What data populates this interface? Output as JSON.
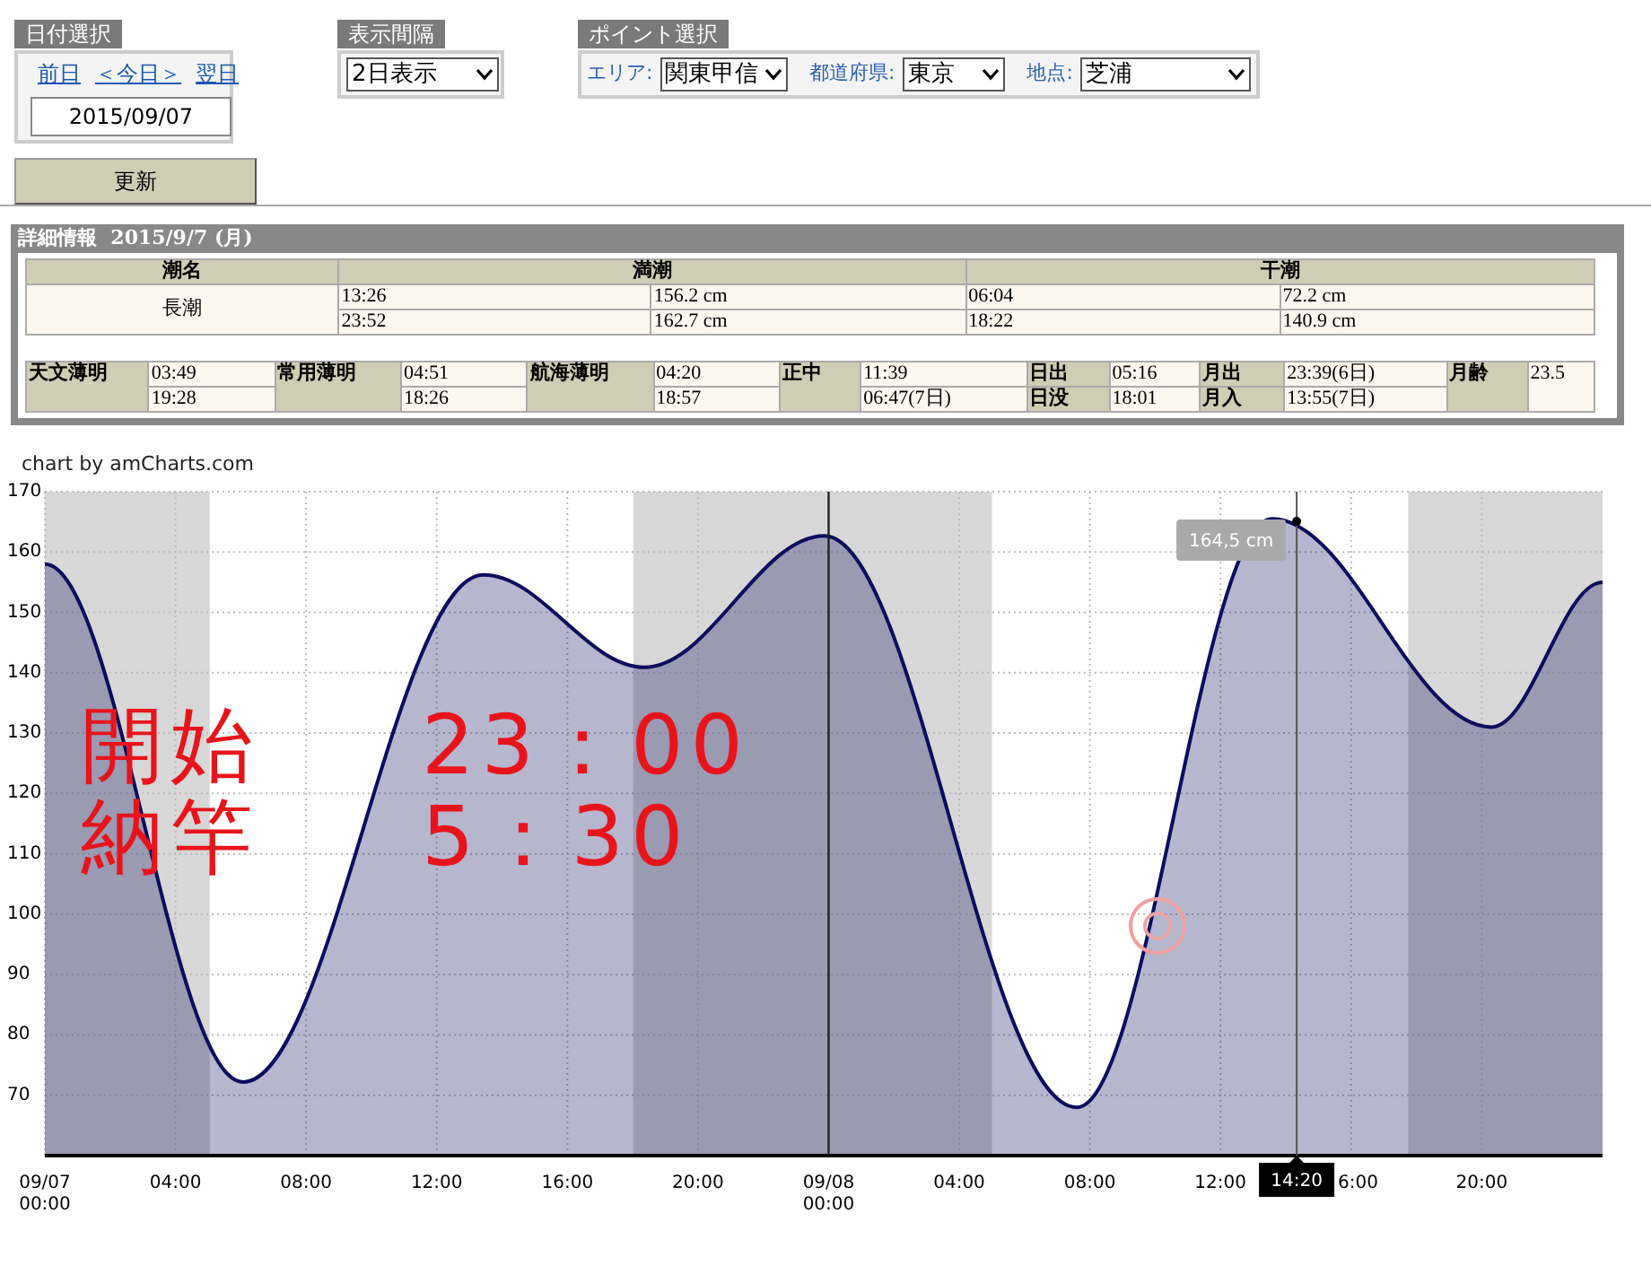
{
  "date_select": {
    "title": "日付選択",
    "links": [
      "前日",
      "＜今日＞",
      "翌日"
    ],
    "date": "2015/09/07"
  },
  "update_button": "更新",
  "interval_select": {
    "title": "表示間隔",
    "value": "2日表示"
  },
  "point_select": {
    "title": "ポイント選択",
    "fields": [
      {
        "label": "エリア:",
        "value": "関東甲信"
      },
      {
        "label": "都道府県:",
        "value": "東京"
      },
      {
        "label": "地点:",
        "value": "芝浦"
      }
    ]
  },
  "details": {
    "title": "詳細情報",
    "date": "2015/9/7 (月)",
    "tide_table": {
      "columns": [
        "潮名",
        "満潮",
        "干潮"
      ],
      "tide_name": "長潮",
      "rows": [
        {
          "high_time": "13:26",
          "high_level": "156.2 cm",
          "low_time": "06:04",
          "low_level": "72.2 cm"
        },
        {
          "high_time": "23:52",
          "high_level": "162.7 cm",
          "low_time": "18:22",
          "low_level": "140.9 cm"
        }
      ]
    },
    "astro": [
      {
        "kind": "span",
        "label": "天文薄明",
        "values": [
          "03:49",
          "19:28"
        ]
      },
      {
        "kind": "span",
        "label": "常用薄明",
        "values": [
          "04:51",
          "18:26"
        ]
      },
      {
        "kind": "span",
        "label": "航海薄明",
        "values": [
          "04:20",
          "18:57"
        ]
      },
      {
        "kind": "span",
        "label": "正中",
        "values": [
          "11:39",
          "06:47(7日)"
        ]
      },
      {
        "kind": "pair",
        "labels": [
          "日出",
          "日没"
        ],
        "values": [
          "05:16",
          "18:01"
        ]
      },
      {
        "kind": "pair",
        "labels": [
          "月出",
          "月入"
        ],
        "values": [
          "23:39(6日)",
          "13:55(7日)"
        ]
      },
      {
        "kind": "single",
        "label": "月齢",
        "value": "23.5"
      }
    ]
  },
  "chart_credit": "chart by amCharts.com",
  "chart": {
    "chart_data": {
      "type": "area",
      "grid": true,
      "x": [
        "2015-09-07T00:00",
        "2015-09-07T06:04",
        "2015-09-07T13:26",
        "2015-09-07T18:22",
        "2015-09-07T23:52",
        "2015-09-08T07:36",
        "2015-09-08T13:35",
        "2015-09-08T20:18",
        "2015-09-08T23:42"
      ],
      "series": [
        {
          "color": "#0d0d5e",
          "values": [
            158,
            72.2,
            156.2,
            140.9,
            162.7,
            68,
            165.5,
            131,
            155
          ]
        }
      ],
      "xlim": [
        "2015-09-07T00:00",
        "2015-09-08T23:42"
      ],
      "ylim": [
        60,
        170
      ],
      "yticks": [
        70,
        80,
        90,
        100,
        110,
        120,
        130,
        140,
        150,
        160,
        170
      ],
      "xticks": [
        {
          "value": "2015-09-07T00:00",
          "label": "09/07 00:00"
        },
        {
          "value": "2015-09-07T04:00",
          "label": "04:00"
        },
        {
          "value": "2015-09-07T08:00",
          "label": "08:00"
        },
        {
          "value": "2015-09-07T12:00",
          "label": "12:00"
        },
        {
          "value": "2015-09-07T16:00",
          "label": "16:00"
        },
        {
          "value": "2015-09-07T20:00",
          "label": "20:00"
        },
        {
          "value": "2015-09-08T00:00",
          "label": "09/08 00:00"
        },
        {
          "value": "2015-09-08T04:00",
          "label": "04:00"
        },
        {
          "value": "2015-09-08T08:00",
          "label": "08:00"
        },
        {
          "value": "2015-09-08T12:00",
          "label": "12:00"
        },
        {
          "value": "2015-09-08T16:00",
          "label": "6:00"
        },
        {
          "value": "2015-09-08T20:00",
          "label": "20:00"
        }
      ],
      "bands": [
        {
          "axis": "x",
          "from": "2015-09-07T00:00",
          "to": "2015-09-07T05:03"
        },
        {
          "axis": "x",
          "from": "2015-09-07T18:01",
          "to": "2015-09-08T05:00"
        },
        {
          "axis": "x",
          "from": "2015-09-08T17:45",
          "to": "2015-09-08T23:42"
        }
      ],
      "ref_lines": [
        {
          "axis": "x",
          "value": "2015-09-08T00:00"
        },
        {
          "axis": "x",
          "value": "2015-09-08T14:20",
          "label": "14:20"
        }
      ],
      "annotations": [
        {
          "text": "164,5 cm",
          "x": "2015-09-08T14:20",
          "y": 164.5
        },
        "開始",
        "23：00",
        "納竿",
        "5：30"
      ]
    }
  }
}
